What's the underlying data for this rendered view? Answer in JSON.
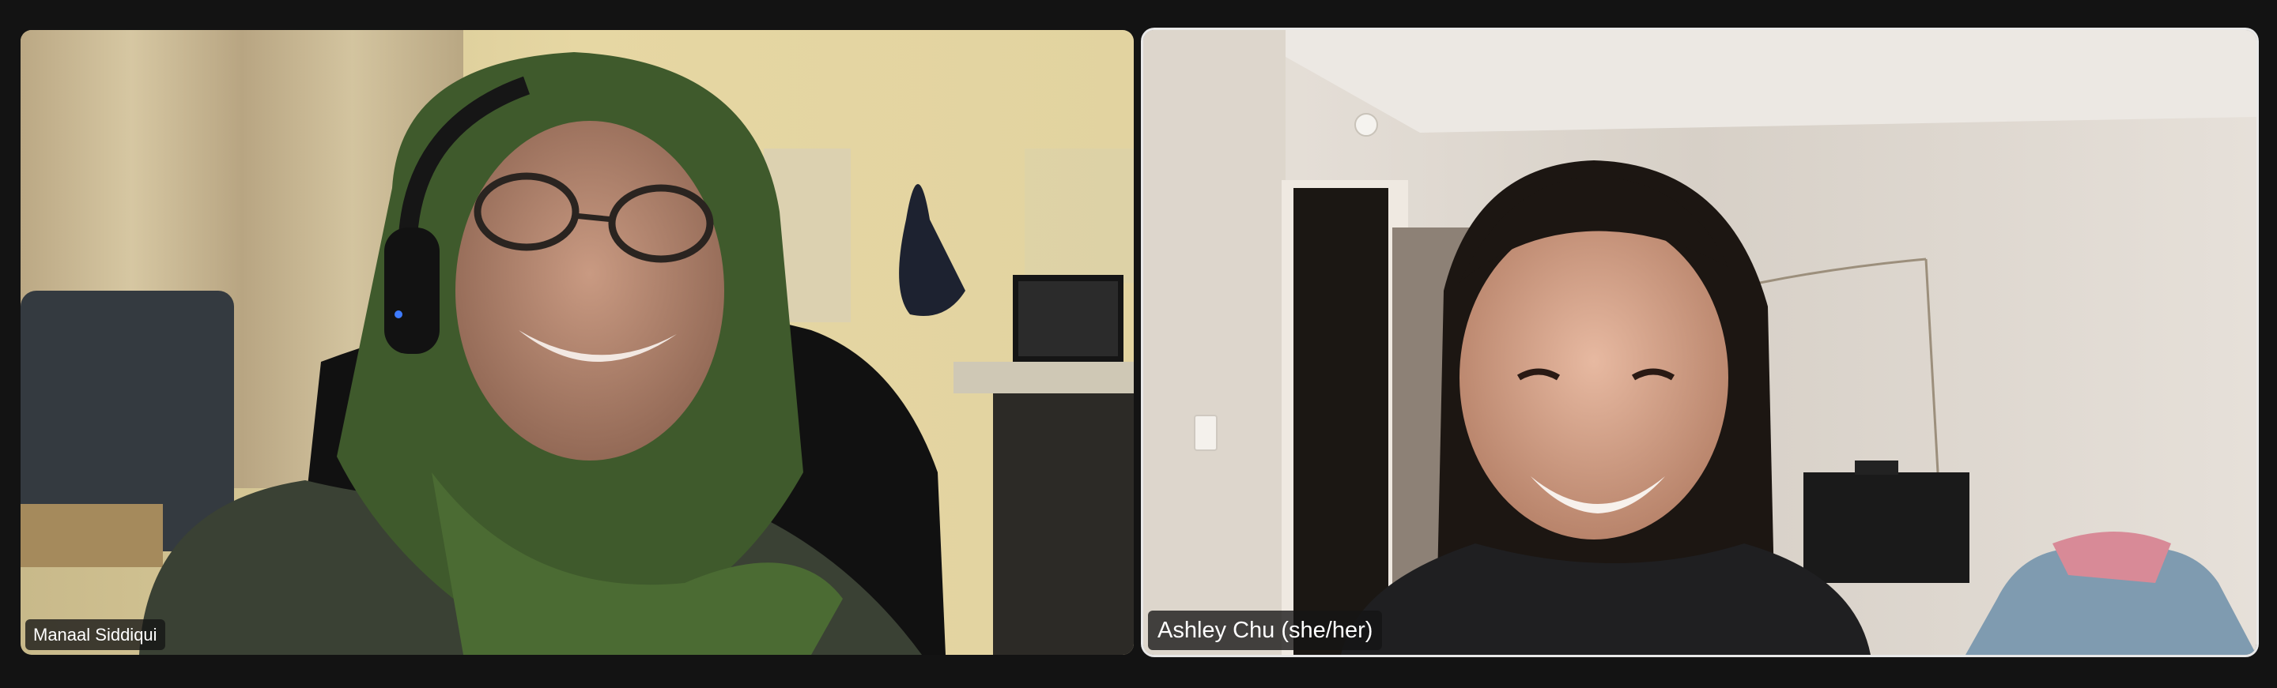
{
  "meeting": {
    "participants": [
      {
        "name": "Manaal Siddiqui",
        "active_speaker": false
      },
      {
        "name": "Ashley Chu (she/her)",
        "active_speaker": true
      }
    ]
  },
  "colors": {
    "background": "#131313",
    "name_tag_bg": "#141414",
    "active_border": "#e9e9e9"
  }
}
